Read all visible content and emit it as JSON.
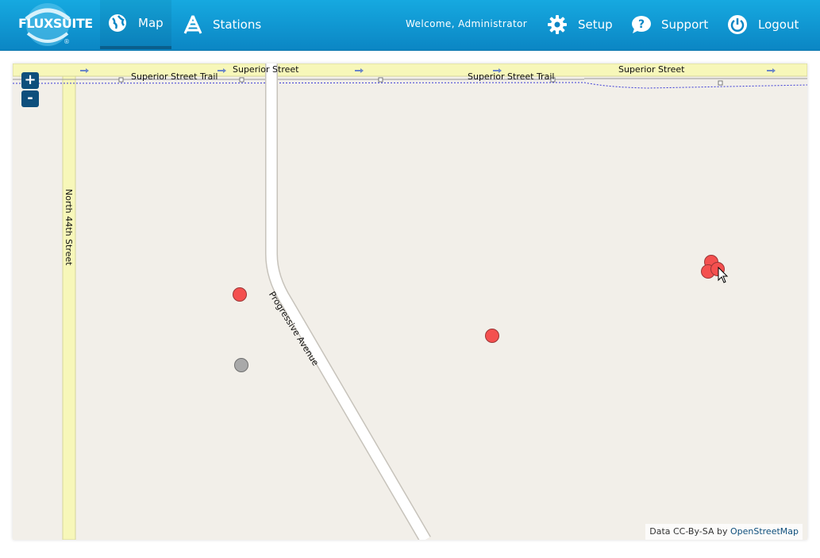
{
  "header": {
    "logo_text": "FLUXSUITE",
    "logo_mark": "®",
    "nav": {
      "map": "Map",
      "stations": "Stations",
      "setup": "Setup",
      "support": "Support",
      "logout": "Logout"
    },
    "welcome": "Welcome, Administrator"
  },
  "map": {
    "zoom_in": "+",
    "zoom_out": "-",
    "streets": {
      "superior_street": "Superior Street",
      "superior_street_trail": "Superior Street Trail",
      "north_44th": "North 44th Street",
      "progressive_ave": "Progressive Avenue"
    },
    "attribution_prefix": "Data CC-By-SA by",
    "attribution_link": "OpenStreetMap"
  },
  "colors": {
    "header": "#0b86c4",
    "marker_active": "#f4504f",
    "marker_inactive": "#a9a9a9",
    "zoom_button": "#0e4f7c"
  }
}
